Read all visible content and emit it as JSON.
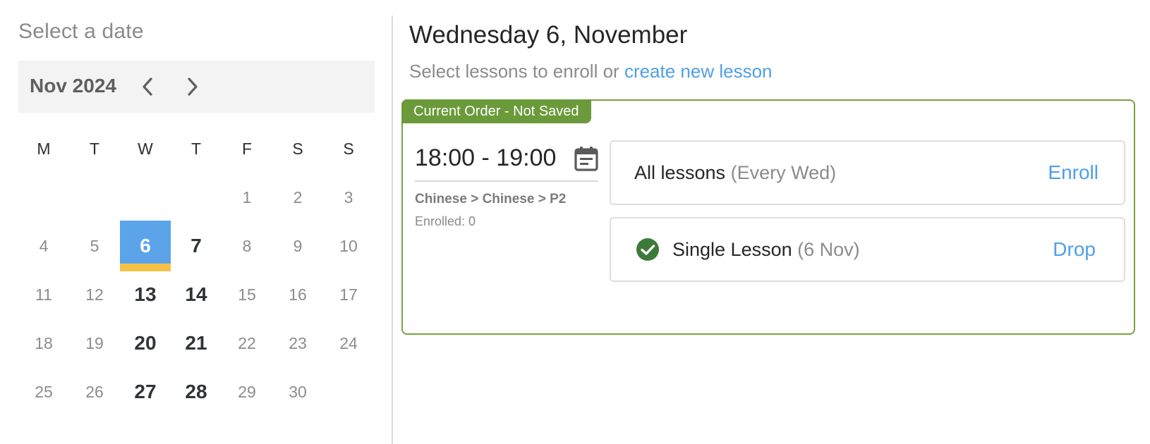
{
  "picker": {
    "title": "Select a date",
    "month_label": "Nov 2024",
    "prev_icon": "chevron-left-icon",
    "next_icon": "chevron-right-icon",
    "weekdays": [
      "M",
      "T",
      "W",
      "T",
      "F",
      "S",
      "S"
    ],
    "weeks": [
      [
        "",
        "",
        "",
        "",
        "1",
        "2",
        "3"
      ],
      [
        "4",
        "5",
        "6",
        "7",
        "8",
        "9",
        "10"
      ],
      [
        "11",
        "12",
        "13",
        "14",
        "15",
        "16",
        "17"
      ],
      [
        "18",
        "19",
        "20",
        "21",
        "22",
        "23",
        "24"
      ],
      [
        "25",
        "26",
        "27",
        "28",
        "29",
        "30",
        ""
      ]
    ],
    "selected_day": "6",
    "lesson_days": [
      "6",
      "7",
      "13",
      "14",
      "20",
      "21",
      "27",
      "28"
    ],
    "colors": {
      "selected": "#5ba4ea",
      "today_marker": "#f5c248"
    }
  },
  "panel": {
    "date_heading": "Wednesday 6, November",
    "subline_prefix": "Select lessons to enroll or ",
    "subline_link": "create new lesson",
    "order_tag": "Current Order - Not Saved",
    "time": "18:00 - 19:00",
    "calendar_icon": "calendar-icon",
    "path": "Chinese > Chinese > P2",
    "enrolled": "Enrolled: 0",
    "all_lessons": {
      "label": "All lessons",
      "detail": "(Every Wed)",
      "action": "Enroll"
    },
    "single_lesson": {
      "label": "Single Lesson",
      "detail": "(6 Nov)",
      "action": "Drop",
      "icon": "check-circle-icon",
      "checked": true
    },
    "colors": {
      "order_border": "#7aa243",
      "order_tag": "#6a9a3a",
      "link": "#4f9fe8",
      "check": "#3c7a3a"
    }
  }
}
